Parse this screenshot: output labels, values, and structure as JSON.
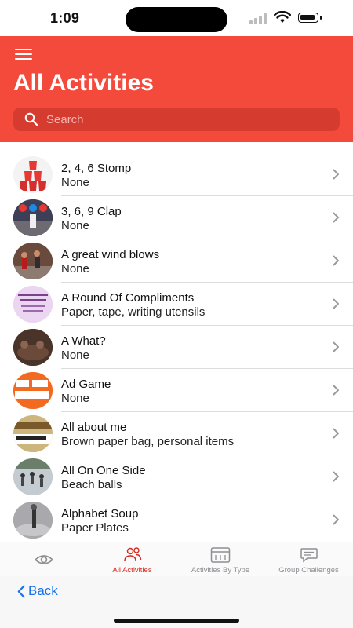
{
  "status": {
    "time": "1:09"
  },
  "header": {
    "title": "All Activities",
    "search_placeholder": "Search"
  },
  "activities": [
    {
      "title": "2, 4, 6 Stomp",
      "materials": "None"
    },
    {
      "title": "3, 6, 9 Clap",
      "materials": "None"
    },
    {
      "title": "A great wind blows",
      "materials": "None"
    },
    {
      "title": "A Round Of Compliments",
      "materials": "Paper, tape, writing utensils"
    },
    {
      "title": "A What?",
      "materials": "None"
    },
    {
      "title": "Ad Game",
      "materials": "None"
    },
    {
      "title": "All about me",
      "materials": "Brown paper bag, personal items"
    },
    {
      "title": "All On One Side",
      "materials": "Beach balls"
    },
    {
      "title": "Alphabet Soup",
      "materials": "Paper Plates"
    }
  ],
  "tabs": [
    {
      "label": "",
      "icon": "eye-icon"
    },
    {
      "label": "All Activities",
      "icon": "people-icon",
      "active": true
    },
    {
      "label": "Activities By Type",
      "icon": "calendar-icon"
    },
    {
      "label": "Group Challenges",
      "icon": "chat-icon"
    }
  ],
  "bottom": {
    "back_label": "Back"
  },
  "colors": {
    "accent": "#f44a3b",
    "active_tab": "#d9281e",
    "link": "#1a73e8"
  }
}
